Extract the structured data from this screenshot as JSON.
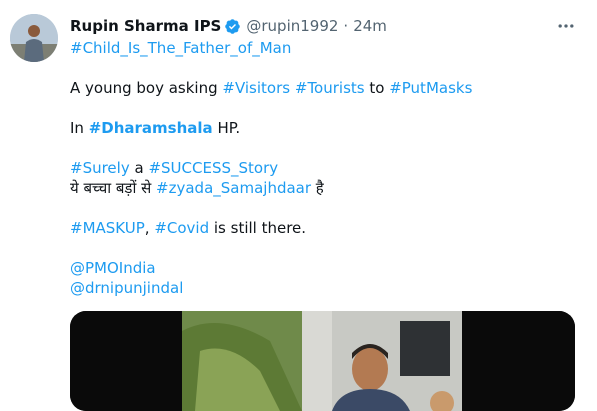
{
  "author": {
    "name": "Rupin Sharma IPS",
    "handle": "@rupin1992",
    "separator": "·",
    "time": "24m"
  },
  "icons": {
    "avatar": "profile-photo",
    "verified": "verified-badge-icon",
    "more": "more-options-icon"
  },
  "colors": {
    "hashtag": "#1d9bf0",
    "text": "#0f1419",
    "secondary": "#536471"
  },
  "tweet": {
    "line1": {
      "tag": "#Child_Is_The_Father_of_Man"
    },
    "line2": {
      "t1": "A young boy asking ",
      "tag1": "#Visitors",
      "sp1": " ",
      "tag2": "#Tourists",
      "t2": " to ",
      "tag3": "#PutMasks"
    },
    "line3": {
      "t1": "In ",
      "tag": "#Dharamshala",
      "t2": " HP."
    },
    "line4": {
      "tag1": "#Surely",
      "t1": " a ",
      "tag2": "#SUCCESS_Story"
    },
    "line5": {
      "t1": "ये बच्चा बड़ों से ",
      "tag": "#zyada_Samajhdaar",
      "t2": " है"
    },
    "line6": {
      "tag1": "#MASKUP",
      "t1": ", ",
      "tag2": "#Covid",
      "t2": " is still there."
    },
    "line7": {
      "mention": "@PMOIndia"
    },
    "line8": {
      "mention": "@drnipunjindal"
    }
  },
  "media": {
    "type": "video"
  }
}
